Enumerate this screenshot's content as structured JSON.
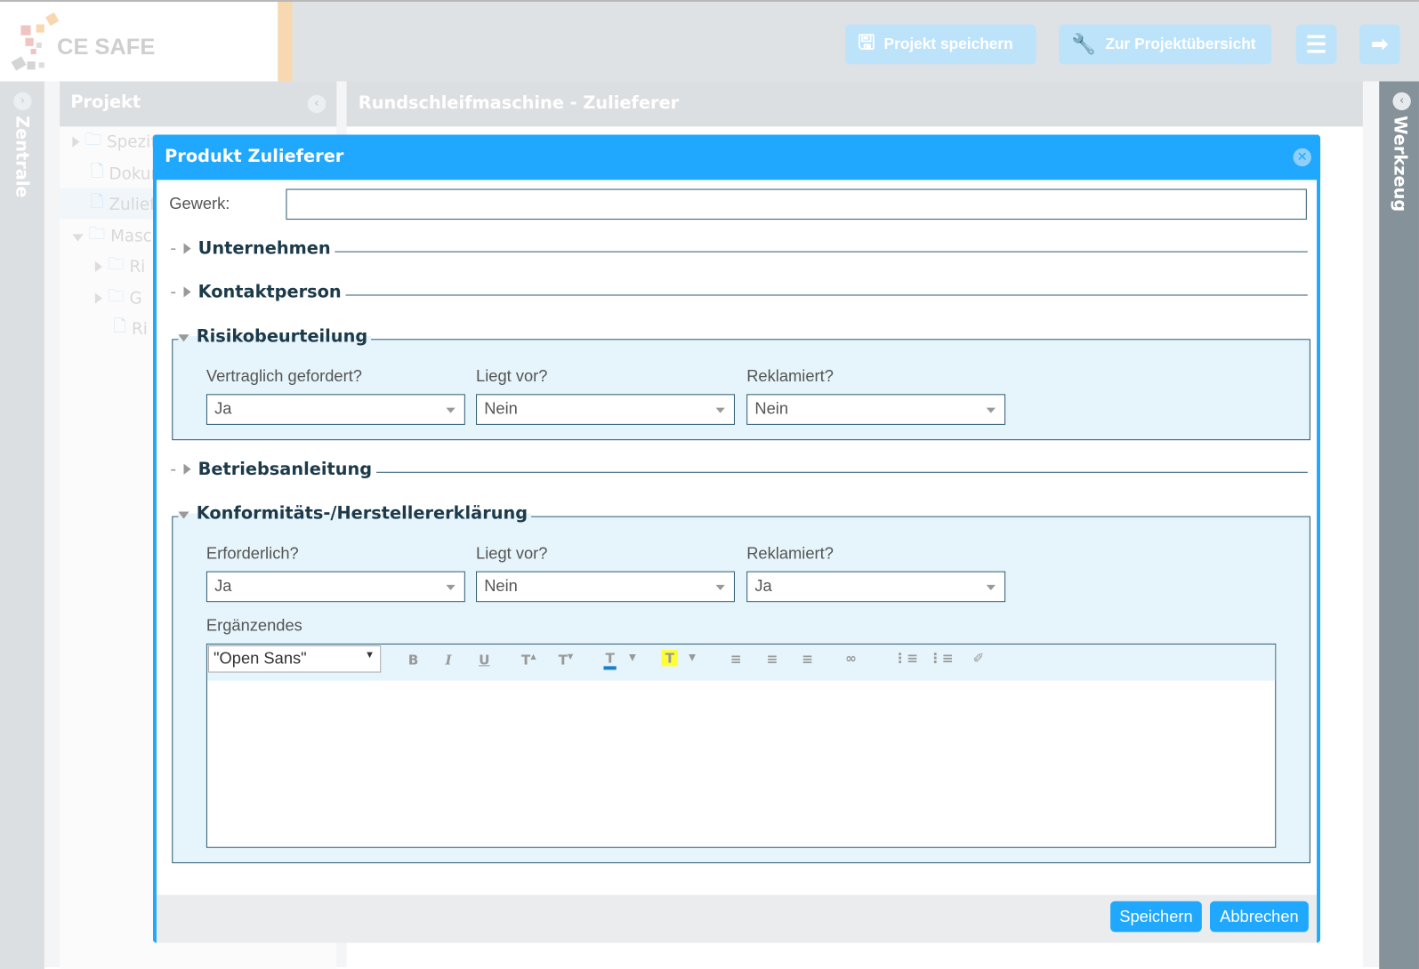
{
  "header": {
    "logo": "CE SAFE",
    "save_project": "Projekt speichern",
    "project_overview": "Zur Projektübersicht",
    "menu_icon": "hamburger-icon",
    "logout_icon": "logout-icon"
  },
  "left_sidebar": {
    "label": "Zentrale"
  },
  "right_sidebar": {
    "label": "Werkzeug"
  },
  "project_panel": {
    "title": "Projekt",
    "items": [
      {
        "label": "Spezifikation"
      },
      {
        "label": "Dokumente"
      },
      {
        "label": "Zulieferer"
      },
      {
        "label": "Maschine"
      },
      {
        "label": "Ri"
      },
      {
        "label": "G"
      },
      {
        "label": "Ri"
      }
    ]
  },
  "main": {
    "title": "Rundschleifmaschine - Zulieferer"
  },
  "modal": {
    "title": "Produkt Zulieferer",
    "gewerk_label": "Gewerk:",
    "gewerk_value": "",
    "sections": {
      "unternehmen": "Unternehmen",
      "kontaktperson": "Kontaktperson",
      "betriebsanleitung": "Betriebsanleitung"
    },
    "risiko": {
      "title": "Risikobeurteilung",
      "fields": [
        {
          "label": "Vertraglich gefordert?",
          "value": "Ja"
        },
        {
          "label": "Liegt vor?",
          "value": "Nein"
        },
        {
          "label": "Reklamiert?",
          "value": "Nein"
        }
      ]
    },
    "konform": {
      "title": "Konformitäts-/Herstellererklärung",
      "fields": [
        {
          "label": "Erforderlich?",
          "value": "Ja"
        },
        {
          "label": "Liegt vor?",
          "value": "Nein"
        },
        {
          "label": "Reklamiert?",
          "value": "Ja"
        }
      ],
      "extra_label": "Ergänzendes",
      "font_select": "\"Open Sans\"",
      "editor_content": ""
    },
    "save": "Speichern",
    "cancel": "Abbrechen"
  },
  "colors": {
    "accent": "#1fa8fd",
    "border": "#2f5b72",
    "fieldset_bg": "#e6f4fb",
    "highlight": "#ffff33",
    "text_color_bar": "#1a7fd0"
  }
}
